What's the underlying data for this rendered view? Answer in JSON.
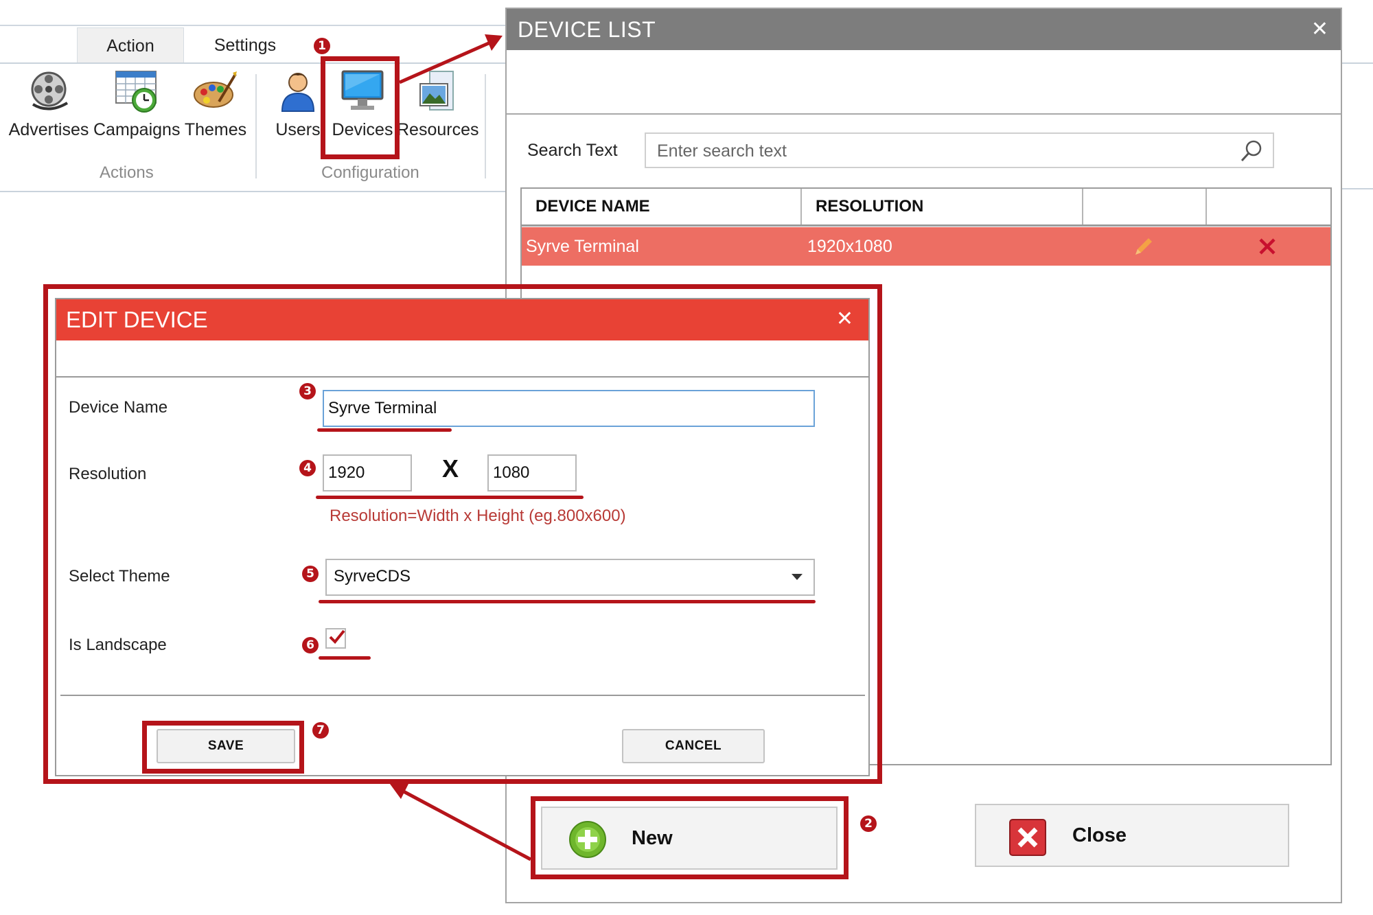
{
  "ribbon": {
    "tabs": [
      {
        "label": "Action",
        "active": true
      },
      {
        "label": "Settings",
        "active": false
      }
    ],
    "items": [
      {
        "label": "Advertises",
        "icon": "film-reel-icon"
      },
      {
        "label": "Campaigns",
        "icon": "calendar-clock-icon"
      },
      {
        "label": "Themes",
        "icon": "palette-icon"
      },
      {
        "label": "Users",
        "icon": "user-icon"
      },
      {
        "label": "Devices",
        "icon": "monitor-icon"
      },
      {
        "label": "Resources",
        "icon": "image-document-icon"
      }
    ],
    "groups": [
      {
        "label": "Actions"
      },
      {
        "label": "Configuration"
      }
    ]
  },
  "device_list": {
    "title": "DEVICE LIST",
    "close_glyph": "✕",
    "search_label": "Search Text",
    "search_placeholder": "Enter search text",
    "columns": [
      "DEVICE NAME",
      "RESOLUTION",
      "",
      ""
    ],
    "rows": [
      {
        "device_name": "Syrve Terminal",
        "resolution": "1920x1080",
        "selected": true
      }
    ],
    "new_button": "New",
    "close_button": "Close"
  },
  "edit_device": {
    "title": "EDIT DEVICE",
    "close_glyph": "✕",
    "device_name_label": "Device Name",
    "device_name_value": "Syrve Terminal",
    "resolution_label": "Resolution",
    "width_value": "1920",
    "height_value": "1080",
    "x_separator": "X",
    "resolution_hint": "Resolution=Width x Height (eg.800x600)",
    "theme_label": "Select Theme",
    "theme_value": "SyrveCDS",
    "landscape_label": "Is Landscape",
    "landscape_checked": true,
    "save_button": "SAVE",
    "cancel_button": "CANCEL"
  },
  "annotations": {
    "steps": [
      "1",
      "2",
      "3",
      "4",
      "5",
      "6",
      "7"
    ]
  },
  "colors": {
    "accent_red": "#e84235",
    "selected_row": "#ed6e63",
    "annotation_red": "#b5141a",
    "title_gray": "#7d7d7d",
    "hint_red": "#b83a36"
  }
}
